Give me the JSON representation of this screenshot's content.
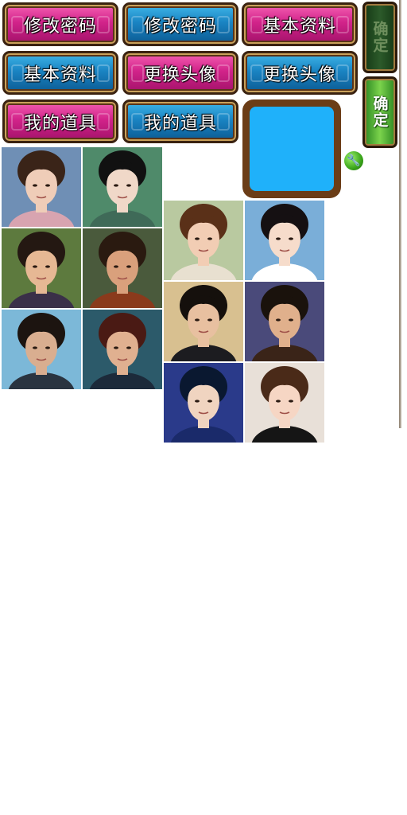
{
  "buttons": {
    "change_password_pink": "修改密码",
    "change_password_blue": "修改密码",
    "basic_info_pink": "基本资料",
    "basic_info_blue": "基本资料",
    "change_avatar_pink": "更换头像",
    "change_avatar_blue": "更换头像",
    "my_items_pink": "我的道具",
    "my_items_blue": "我的道具"
  },
  "confirm": {
    "disabled_label": "确定",
    "active_label": "确定"
  },
  "colors": {
    "pink_button": "#d2238a",
    "blue_button": "#1a84c3",
    "avatar_fill": "#1fb1fa",
    "avatar_frame": "#6b3d17",
    "confirm_active": "#4fb332"
  },
  "icons": {
    "wrench": "wrench-icon"
  },
  "portraits": {
    "left_group": [
      {
        "name": "portrait-woman-short-hair",
        "bg": "#6f8fb5",
        "skin": "#efcdb8",
        "hair": "#3a2418",
        "shirt": "#d8a4b0"
      },
      {
        "name": "portrait-woman-glasses",
        "bg": "#4f8a6a",
        "skin": "#f0d8c8",
        "hair": "#111111",
        "shirt": "#3f6a58"
      },
      {
        "name": "portrait-man-fringe",
        "bg": "#5d7a3e",
        "skin": "#e6b894",
        "hair": "#241812",
        "shirt": "#3a3048"
      },
      {
        "name": "portrait-man-long-hair",
        "bg": "#4a5a3c",
        "skin": "#d9a07c",
        "hair": "#2a1a10",
        "shirt": "#8a3a1c"
      },
      {
        "name": "portrait-man-sunglasses",
        "bg": "#7cb8d8",
        "skin": "#d9ae90",
        "hair": "#1c1410",
        "shirt": "#2a3440"
      },
      {
        "name": "portrait-man-dark-hair",
        "bg": "#2c5a6a",
        "skin": "#e0b090",
        "hair": "#4a1a14",
        "shirt": "#1c2a3a"
      }
    ],
    "right_group": [
      {
        "name": "portrait-woman-bob",
        "bg": "#b9c9a0",
        "skin": "#f2cdb4",
        "hair": "#5a3018",
        "shirt": "#e8e0d0"
      },
      {
        "name": "portrait-woman-long-black-hair",
        "bg": "#7aaed8",
        "skin": "#f6dccb",
        "hair": "#151012",
        "shirt": "#ffffff"
      },
      {
        "name": "portrait-man-curly-hair",
        "bg": "#d8c090",
        "skin": "#e8c0a0",
        "hair": "#15100c",
        "shirt": "#1c1c20"
      },
      {
        "name": "portrait-man-leather-jacket",
        "bg": "#4a4a7a",
        "skin": "#e0b08c",
        "hair": "#1a120c",
        "shirt": "#3a2418"
      },
      {
        "name": "portrait-man-blue-hair",
        "bg": "#2a3a8a",
        "skin": "#f0d4c0",
        "hair": "#0a1830",
        "shirt": "#1a2a6a"
      },
      {
        "name": "portrait-woman-smiling",
        "bg": "#e8e0d8",
        "skin": "#f6d6c4",
        "hair": "#4a2a18",
        "shirt": "#151515"
      }
    ]
  }
}
